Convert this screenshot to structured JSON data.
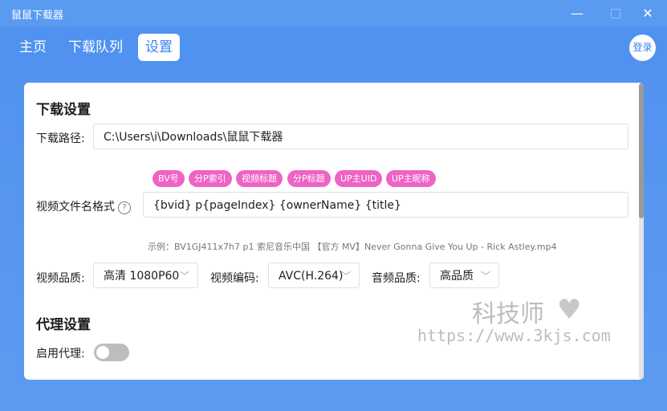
{
  "window": {
    "title": "鼠鼠下载器",
    "minimize": "—",
    "close": "✕"
  },
  "nav": {
    "tabs": [
      "主页",
      "下载队列",
      "设置"
    ],
    "login": "登录"
  },
  "download": {
    "section_title": "下载设置",
    "path_label": "下载路径:",
    "path_value": "C:\\Users\\i\\Downloads\\鼠鼠下载器",
    "chips": [
      "BV号",
      "分P索引",
      "视频标题",
      "分P标题",
      "UP主UID",
      "UP主昵称"
    ],
    "format_label": "视频文件名格式",
    "format_help": "?",
    "format_value": "{bvid} p{pageIndex} {ownerName} {title}",
    "example": "示例：BV1GJ411x7h7 p1 索尼音乐中国 【官方 MV】Never Gonna Give You Up - Rick Astley.mp4",
    "quality_label": "视频品质:",
    "quality_value": "高清 1080P60",
    "codec_label": "视频编码:",
    "codec_value": "AVC(H.264)",
    "audio_label": "音频品质:",
    "audio_value": "高品质"
  },
  "proxy": {
    "section_title": "代理设置",
    "enable_label": "启用代理:",
    "enabled": false
  },
  "watermark": {
    "name": "科技师",
    "heart": "♥",
    "url": "https://www.3kjs.com"
  },
  "colors": {
    "accent": "#5a9bf2",
    "chip": "#ee63c4",
    "text": "#1e1e1e"
  }
}
